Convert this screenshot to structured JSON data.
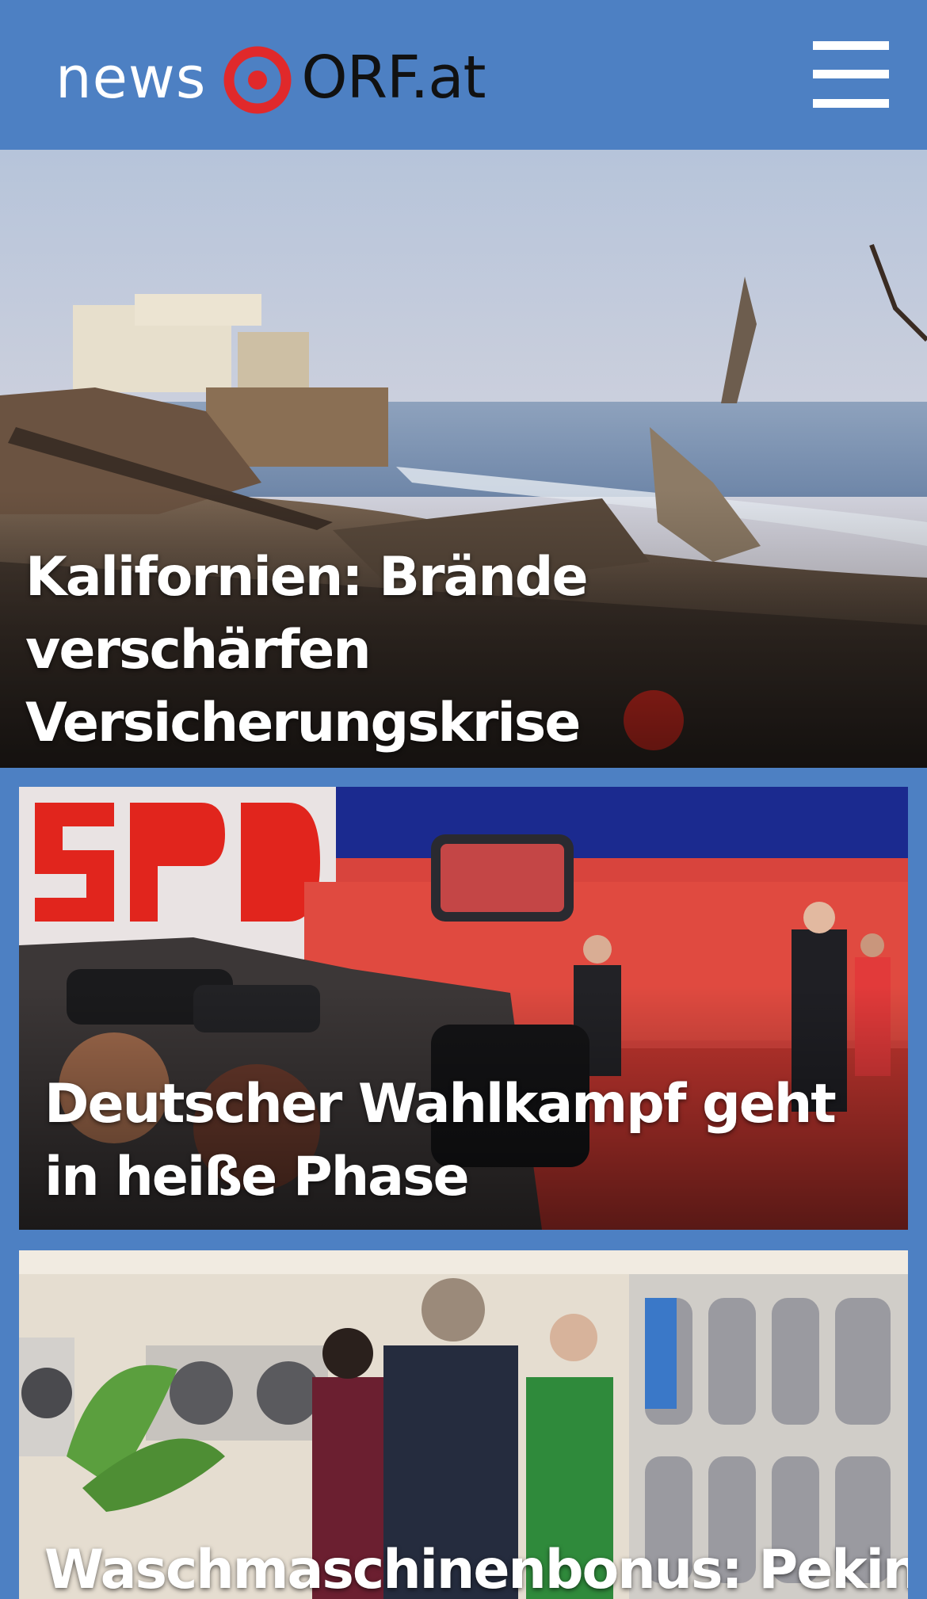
{
  "header": {
    "logo_news": "news",
    "logo_orf": "ORF.at",
    "menu_icon": "hamburger-menu-icon",
    "background_color": "#4d80c3",
    "logo_mark_color": "#e0292b"
  },
  "stories": [
    {
      "title": "Kalifornien: Brände verschärfen Versicherungskrise",
      "image": "burned-beach-houses-photo"
    },
    {
      "title": "Deutscher Wahlkampf geht in heiße Phase",
      "image": "spd-campaign-event-photo"
    },
    {
      "title": "Waschmaschinenbonus: Peking",
      "image": "washing-machine-store-photo"
    }
  ]
}
